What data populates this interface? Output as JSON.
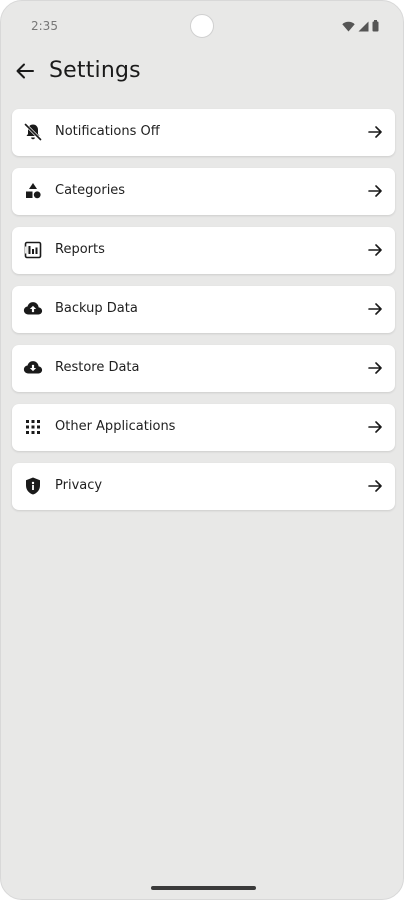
{
  "status_bar": {
    "time": "2:35",
    "icons": [
      "wifi-icon",
      "signal-icon",
      "battery-icon"
    ]
  },
  "header": {
    "title": "Settings",
    "back_icon": "arrow-left-icon"
  },
  "settings": {
    "items": [
      {
        "label": "Notifications Off",
        "icon": "notifications-off-icon"
      },
      {
        "label": "Categories",
        "icon": "categories-icon"
      },
      {
        "label": "Reports",
        "icon": "reports-icon"
      },
      {
        "label": "Backup Data",
        "icon": "cloud-upload-icon"
      },
      {
        "label": "Restore Data",
        "icon": "cloud-download-icon"
      },
      {
        "label": "Other Applications",
        "icon": "apps-grid-icon"
      },
      {
        "label": "Privacy",
        "icon": "shield-icon"
      }
    ]
  },
  "colors": {
    "background": "#e8e8e7",
    "card": "#ffffff",
    "text": "#1f1f1f"
  }
}
